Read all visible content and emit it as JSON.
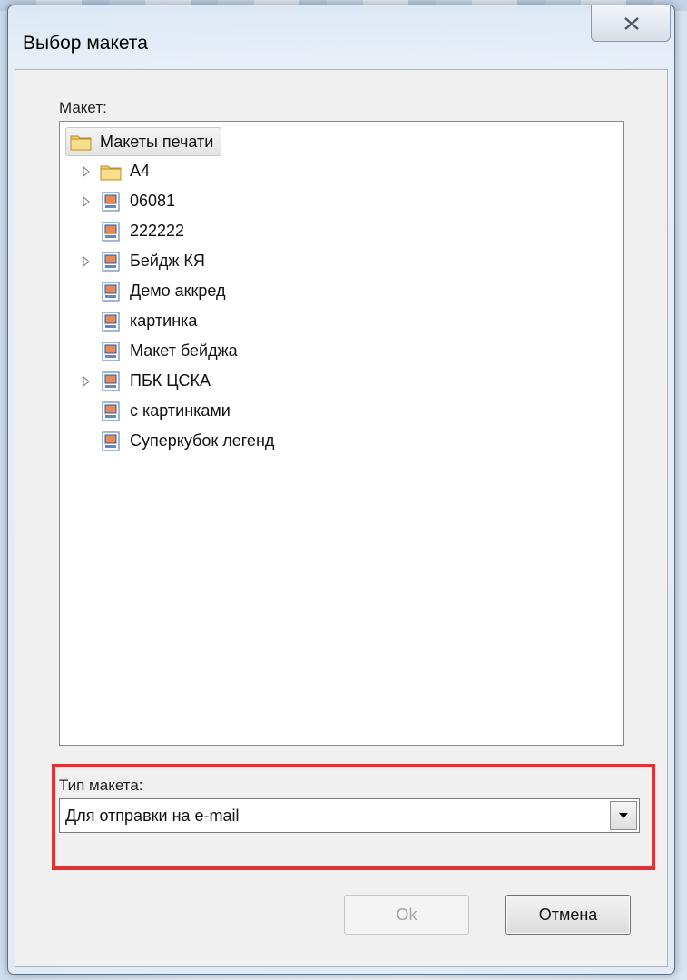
{
  "dialog": {
    "title": "Выбор макета",
    "close_icon": "close-icon"
  },
  "layout_label": "Макет:",
  "tree": {
    "root": {
      "label": "Макеты печати",
      "icon": "folder-icon"
    },
    "items": [
      {
        "label": "A4",
        "icon": "folder-icon",
        "expandable": true
      },
      {
        "label": "06081",
        "icon": "template-icon",
        "expandable": true
      },
      {
        "label": "222222",
        "icon": "template-icon",
        "expandable": false
      },
      {
        "label": "Бейдж КЯ",
        "icon": "template-icon",
        "expandable": true
      },
      {
        "label": "Демо аккред",
        "icon": "template-icon",
        "expandable": false
      },
      {
        "label": "картинка",
        "icon": "template-icon",
        "expandable": false
      },
      {
        "label": "Макет бейджа",
        "icon": "template-icon",
        "expandable": false
      },
      {
        "label": "ПБК ЦСКА",
        "icon": "template-icon",
        "expandable": true
      },
      {
        "label": "с картинками",
        "icon": "template-icon",
        "expandable": false
      },
      {
        "label": "Суперкубок легенд",
        "icon": "template-icon",
        "expandable": false
      }
    ]
  },
  "type_label": "Тип макета:",
  "type_select": {
    "value": "Для отправки на e-mail"
  },
  "buttons": {
    "ok": "Ok",
    "cancel": "Отмена"
  },
  "colors": {
    "highlight": "#e03232",
    "folder": "#f2cf6b"
  }
}
